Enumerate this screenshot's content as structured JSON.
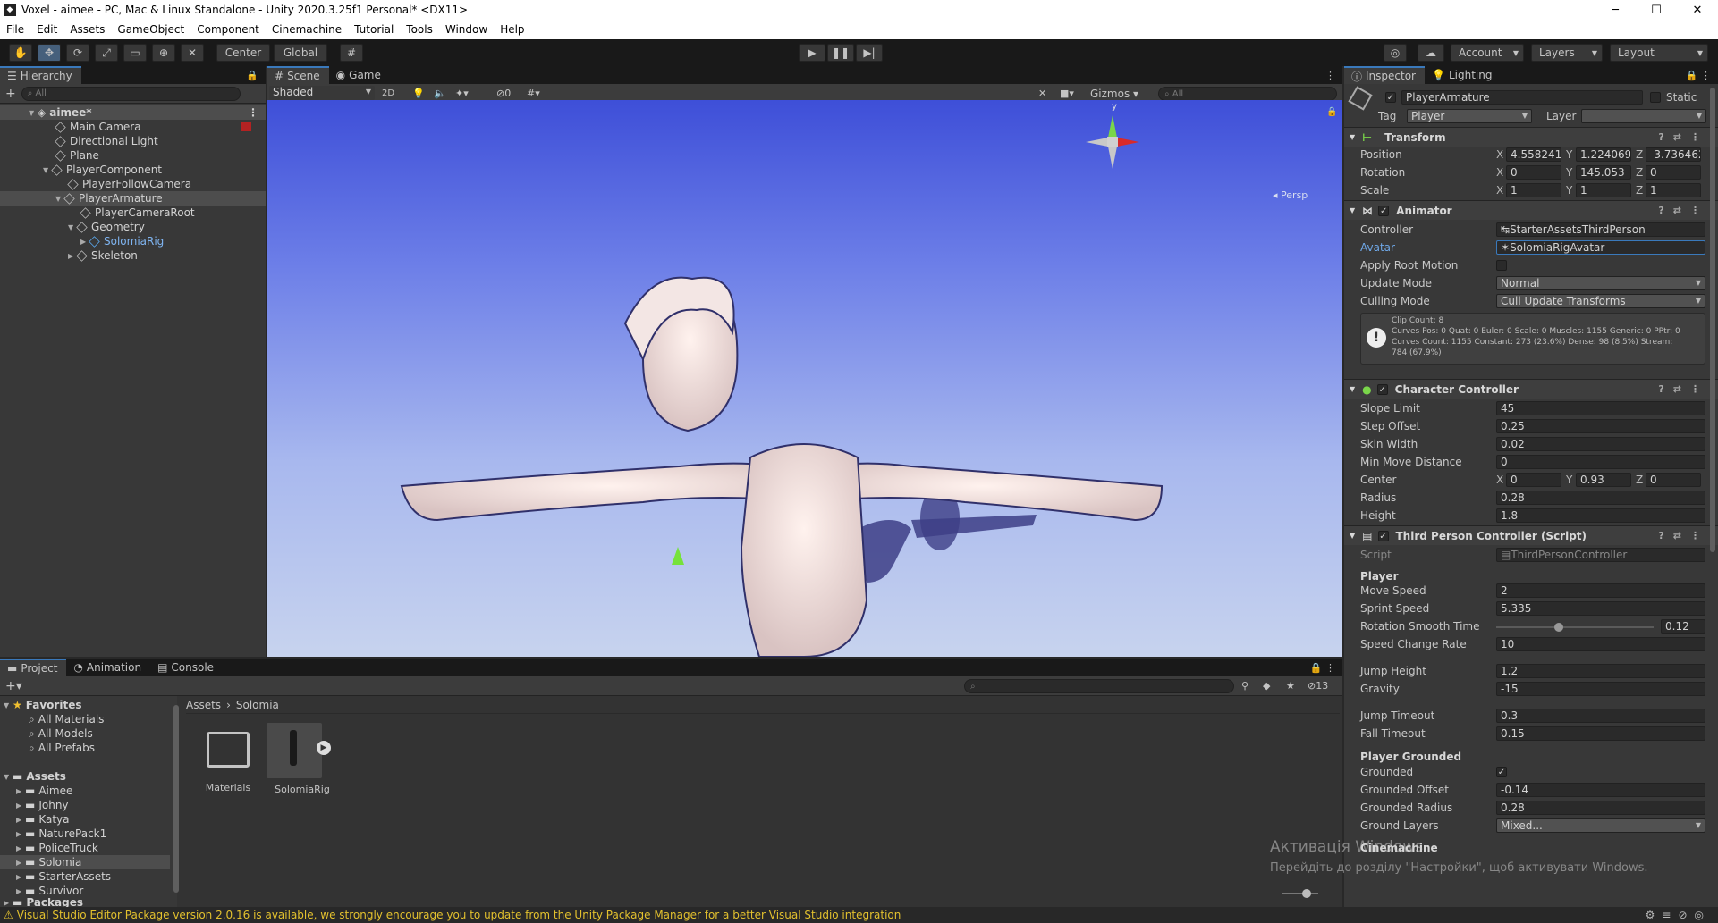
{
  "window": {
    "title": "Voxel - aimee - PC, Mac & Linux Standalone - Unity 2020.3.25f1 Personal* <DX11>",
    "min": "─",
    "max": "☐",
    "close": "✕"
  },
  "menu": [
    "File",
    "Edit",
    "Assets",
    "GameObject",
    "Component",
    "Cinemachine",
    "Tutorial",
    "Tools",
    "Window",
    "Help"
  ],
  "toolbar": {
    "center": "Center",
    "global": "Global",
    "account": "Account",
    "layers": "Layers",
    "layout": "Layout"
  },
  "hierarchy": {
    "tab": "Hierarchy",
    "search": "All",
    "scene": "aimee*",
    "items": [
      {
        "label": "Main Camera"
      },
      {
        "label": "Directional Light"
      },
      {
        "label": "Plane"
      },
      {
        "label": "PlayerComponent"
      },
      {
        "label": "PlayerFollowCamera"
      },
      {
        "label": "PlayerArmature"
      },
      {
        "label": "PlayerCameraRoot"
      },
      {
        "label": "Geometry"
      },
      {
        "label": "SolomiaRig"
      },
      {
        "label": "Skeleton"
      }
    ]
  },
  "scene": {
    "tab_scene": "Scene",
    "tab_game": "Game",
    "shading": "Shaded",
    "mode2d": "2D",
    "hidden_count": "0",
    "gizmos": "Gizmos",
    "search": "All",
    "persp": "Persp",
    "axis_y": "y"
  },
  "project": {
    "tabs": [
      "Project",
      "Animation",
      "Console"
    ],
    "hidden_count": "13",
    "favorites": {
      "label": "Favorites",
      "items": [
        "All Materials",
        "All Models",
        "All Prefabs"
      ]
    },
    "assets": {
      "label": "Assets",
      "items": [
        "Aimee",
        "Johny",
        "Katya",
        "NaturePack1",
        "PoliceTruck",
        "Solomia",
        "StarterAssets",
        "Survivor"
      ]
    },
    "packages": "Packages",
    "breadcrumb": [
      "Assets",
      "Solomia"
    ],
    "files": [
      {
        "label": "Materials"
      },
      {
        "label": "SolomiaRig"
      }
    ]
  },
  "status": {
    "message": "Visual Studio Editor Package version 2.0.16 is available, we strongly encourage you to update from the Unity Package Manager for a better Visual Studio integration"
  },
  "inspector": {
    "tab": "Inspector",
    "tab_lighting": "Lighting",
    "object_name": "PlayerArmature",
    "static": "Static",
    "tag_label": "Tag",
    "tag": "Player",
    "layer_label": "Layer",
    "transform": {
      "title": "Transform",
      "position": {
        "label": "Position",
        "x": "4.558241",
        "y": "1.224069",
        "z": "-3.736462"
      },
      "rotation": {
        "label": "Rotation",
        "x": "0",
        "y": "145.053",
        "z": "0"
      },
      "scale": {
        "label": "Scale",
        "x": "1",
        "y": "1",
        "z": "1"
      }
    },
    "animator": {
      "title": "Animator",
      "controller_label": "Controller",
      "controller": "StarterAssetsThirdPerson",
      "avatar_label": "Avatar",
      "avatar": "SolomiaRigAvatar",
      "apply_root_label": "Apply Root Motion",
      "update_label": "Update Mode",
      "update": "Normal",
      "culling_label": "Culling Mode",
      "culling": "Cull Update Transforms",
      "info1": "Clip Count: 8",
      "info2": "Curves Pos: 0 Quat: 0 Euler: 0 Scale: 0 Muscles: 1155 Generic: 0 PPtr: 0",
      "info3": "Curves Count: 1155 Constant: 273 (23.6%) Dense: 98 (8.5%) Stream:",
      "info4": "784 (67.9%)"
    },
    "cc": {
      "title": "Character Controller",
      "slope_label": "Slope Limit",
      "slope": "45",
      "step_label": "Step Offset",
      "step": "0.25",
      "skin_label": "Skin Width",
      "skin": "0.02",
      "minmove_label": "Min Move Distance",
      "minmove": "0",
      "center_label": "Center",
      "cx": "0",
      "cy": "0.93",
      "cz": "0",
      "radius_label": "Radius",
      "radius": "0.28",
      "height_label": "Height",
      "height": "1.8"
    },
    "tpc": {
      "title": "Third Person Controller (Script)",
      "script_label": "Script",
      "script": "ThirdPersonController",
      "player": "Player",
      "move_label": "Move Speed",
      "move": "2",
      "sprint_label": "Sprint Speed",
      "sprint": "5.335",
      "rot_label": "Rotation Smooth Time",
      "rot": "0.12",
      "rot_fraction": 0.4,
      "scr_label": "Speed Change Rate",
      "scr": "10",
      "jump_label": "Jump Height",
      "jump": "1.2",
      "grav_label": "Gravity",
      "grav": "-15",
      "jt_label": "Jump Timeout",
      "jt": "0.3",
      "ft_label": "Fall Timeout",
      "ft": "0.15",
      "grounded_head": "Player Grounded",
      "grounded_label": "Grounded",
      "go_label": "Grounded Offset",
      "go": "-0.14",
      "gr_label": "Grounded Radius",
      "gr": "0.28",
      "gl_label": "Ground Layers",
      "gl": "Mixed...",
      "cinemachine": "Cinemachine"
    }
  },
  "watermark": {
    "line1": "Активація Windows",
    "line2": "Перейдіть до розділу \"Настройки\", щоб активувати Windows."
  },
  "colors": {
    "accent": "#3a79bb",
    "selection": "#4d4d4d",
    "warning": "#e3c12e",
    "sky_top": "#3e4fd8"
  }
}
